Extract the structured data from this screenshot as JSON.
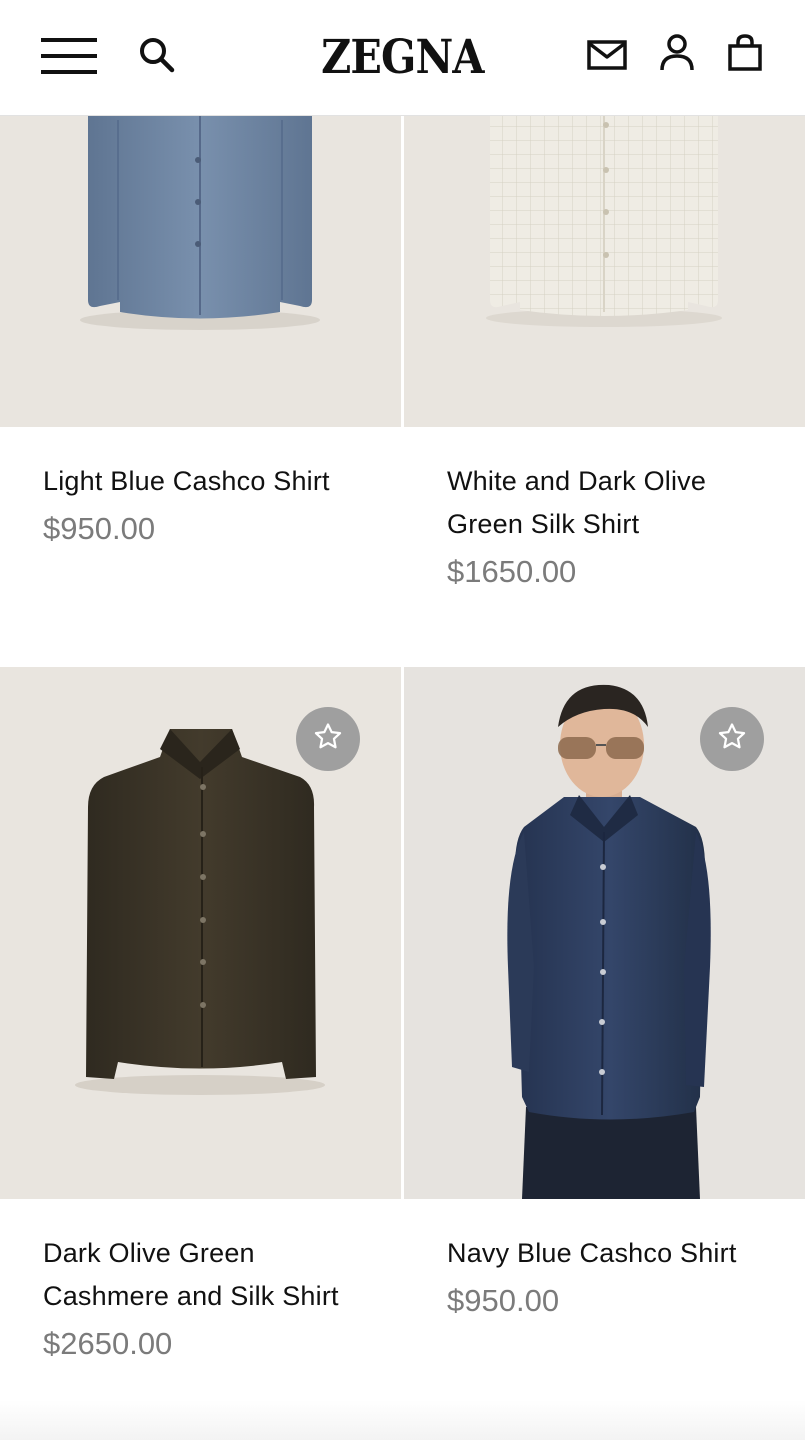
{
  "header": {
    "logo": "ZEGNA",
    "icons": {
      "menu": "hamburger-menu-icon",
      "search": "search-icon",
      "contact": "mail-icon",
      "account": "user-icon",
      "bag": "shopping-bag-icon"
    }
  },
  "products": [
    {
      "name": "Light Blue Cashco Shirt",
      "price": "$950.00",
      "shirt_color": "#6f86a3"
    },
    {
      "name": "White and Dark Olive Green Silk Shirt",
      "price": "$1650.00",
      "shirt_color": "#eeeae0"
    },
    {
      "name": "Dark Olive Green Cashmere and Silk Shirt",
      "price": "$2650.00",
      "shirt_color": "#3b3427"
    },
    {
      "name": "Navy Blue Cashco Shirt",
      "price": "$950.00",
      "shirt_color": "#2f3e5c"
    }
  ],
  "colors": {
    "photo_bg": "#e9e5df",
    "price": "#7b7b7b",
    "wishlist_button": "#9f9f9f"
  },
  "wishlist_icon": "star-outline-icon"
}
